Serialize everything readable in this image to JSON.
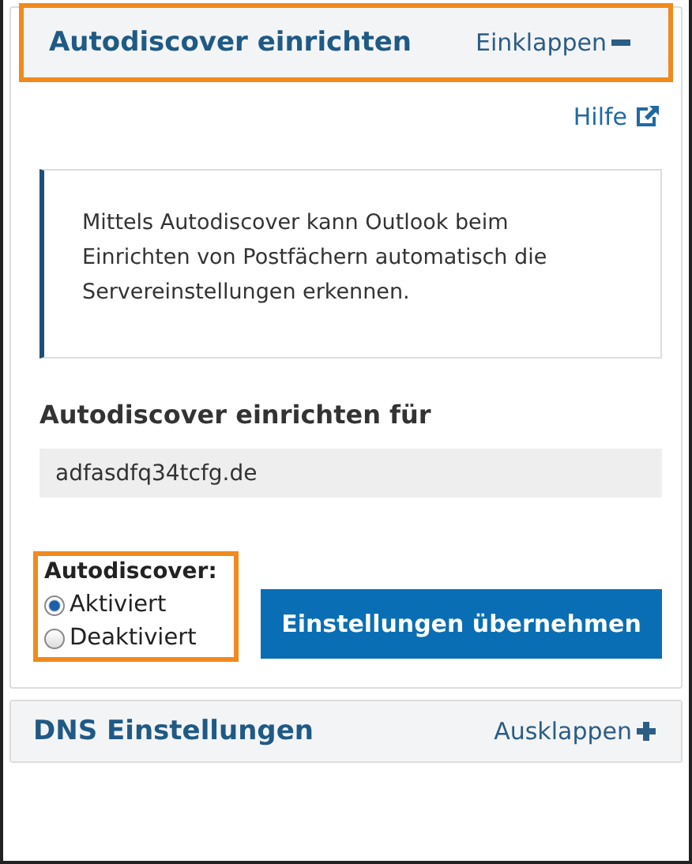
{
  "panels": [
    {
      "title": "Autodiscover einrichten",
      "toggle": "Einklappen",
      "expanded": true,
      "highlighted": true
    },
    {
      "title": "DNS Einstellungen",
      "toggle": "Ausklappen",
      "expanded": false,
      "highlighted": false
    }
  ],
  "help_link": "Hilfe",
  "info": "Mittels Autodiscover kann Outlook beim Einrichten von Postfächern automatisch die Servereinstellungen erkennen.",
  "domain_label": "Autodiscover einrichten für",
  "domain_value": "adfasdfq34tcfg.de",
  "radio_group": {
    "label": "Autodiscover:",
    "highlighted": true,
    "options": [
      {
        "label": "Aktiviert",
        "selected": true
      },
      {
        "label": "Deaktiviert",
        "selected": false
      }
    ]
  },
  "apply_button": "Einstellungen übernehmen"
}
